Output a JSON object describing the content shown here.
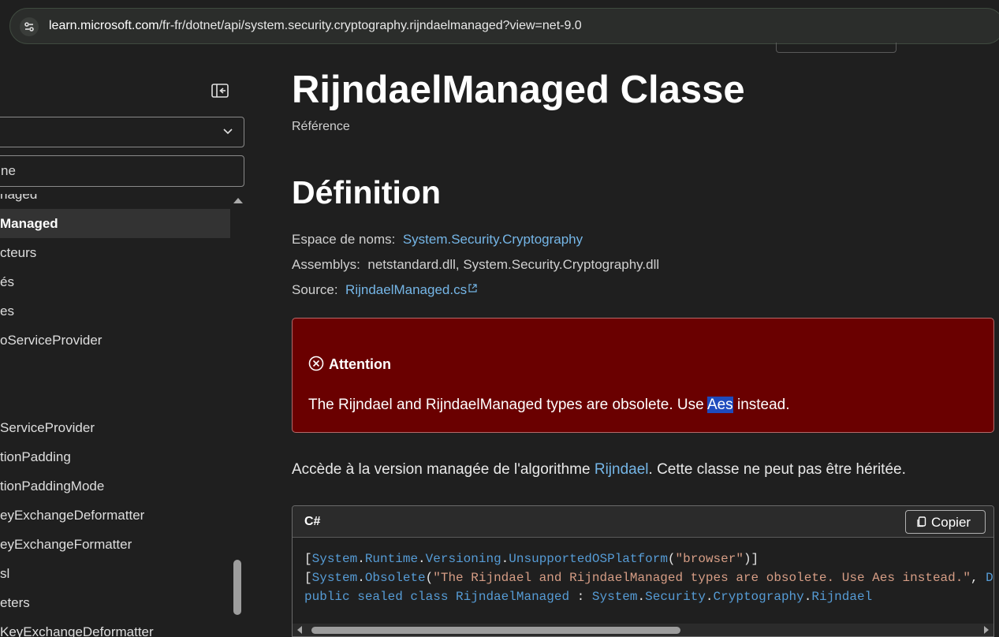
{
  "browser": {
    "url_host": "learn.microsoft.com",
    "url_path": "/fr-fr/dotnet/api/system.security.cryptography.rijndaelmanaged?view=net-9.0"
  },
  "sidebar": {
    "filter_value": "ne",
    "items": [
      {
        "label": "naged"
      },
      {
        "label": "Managed"
      },
      {
        "label": "cteurs"
      },
      {
        "label": "és"
      },
      {
        "label": "es"
      },
      {
        "label": "oServiceProvider"
      },
      {
        "label": "ServiceProvider"
      },
      {
        "label": "tionPadding"
      },
      {
        "label": "tionPaddingMode"
      },
      {
        "label": "eyExchangeDeformatter"
      },
      {
        "label": "eyExchangeFormatter"
      },
      {
        "label": "sl"
      },
      {
        "label": "eters"
      },
      {
        "label": "KeyExchangeDeformatter"
      }
    ]
  },
  "main": {
    "title": "RijndaelManaged Classe",
    "subtitle": "Référence",
    "definition_heading": "Définition",
    "namespace_label": "Espace de noms:",
    "namespace_value": "System.Security.Cryptography",
    "assemblies_label": "Assemblys:",
    "assemblies_value": "netstandard.dll, System.Security.Cryptography.dll",
    "source_label": "Source:",
    "source_value": "RijndaelManaged.cs",
    "alert": {
      "title": "Attention",
      "text_before": "The Rijndael and RijndaelManaged types are obsolete. Use ",
      "text_link": "Aes",
      "text_after": " instead."
    },
    "summary": {
      "before": "Accède à la version managée de l'algorithme ",
      "link": "Rijndael",
      "after": ". Cette classe ne peut pas être héritée."
    },
    "code": {
      "language": "C#",
      "copy_label": "Copier"
    }
  },
  "colors": {
    "background": "#1f1f1f",
    "alert_background": "#6a0000",
    "link": "#75b6e7",
    "code_keyword": "#569cd6",
    "code_string": "#d69d85",
    "code_type": "#4ec9b0"
  }
}
